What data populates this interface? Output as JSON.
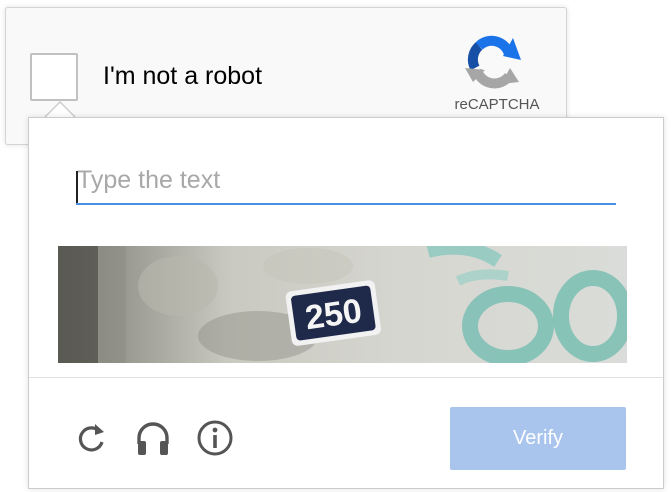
{
  "anchor": {
    "label": "I'm not a robot",
    "brand": "reCAPTCHA",
    "logo_icon": "recaptcha-logo-icon",
    "checked": false
  },
  "challenge": {
    "input_value": "",
    "input_placeholder": "Type the text",
    "captcha_text": "250",
    "icons": [
      "reload-icon",
      "audio-headphones-icon",
      "info-icon"
    ],
    "verify_label": "Verify"
  },
  "colors": {
    "input_underline": "#4a90e2",
    "verify_button": "#a9c5ee",
    "logo_blue": "#1a73e8",
    "logo_grey": "#a6a6a6"
  }
}
